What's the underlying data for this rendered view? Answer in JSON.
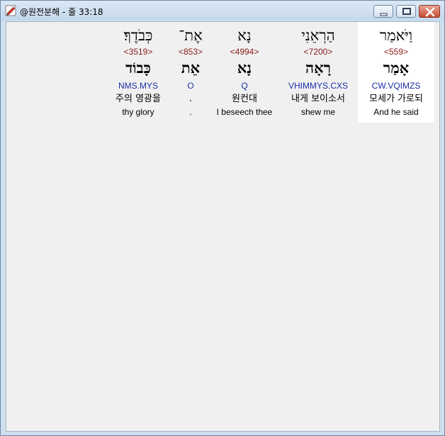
{
  "window": {
    "title": "@원전분해 - 줄 33:18",
    "colors": {
      "strong": "#8b1a1a",
      "morph": "#1a2fa8",
      "current_bg": "#ffffff"
    }
  },
  "icons": {
    "app": "app-icon",
    "minimize": "minimize-icon",
    "maximize": "maximize-icon",
    "close": "close-icon"
  },
  "words": [
    {
      "hebrew": "וַיֹּאמַר",
      "strong": "<559>",
      "lemma": "אָמַר",
      "morph": "CW.VQIMZS",
      "korean": "모세가 가로되",
      "english": "And he said"
    },
    {
      "hebrew": "הַרְאֵנִי",
      "strong": "<7200>",
      "lemma": "רָאָה",
      "morph": "VHIMMYS.CXS",
      "korean": "내게 보이소서",
      "english": "shew me"
    },
    {
      "hebrew": "נָא",
      "strong": "<4994>",
      "lemma": "נָא",
      "morph": "Q",
      "korean": "원컨대",
      "english": "I beseech thee"
    },
    {
      "hebrew": "אֶת־",
      "strong": "<853>",
      "lemma": "אֵת",
      "morph": "O",
      "korean": ".",
      "english": "."
    },
    {
      "hebrew": "כְּבֹדֶךָ׃",
      "strong": "<3519>",
      "lemma": "כָּבוֹד",
      "morph": "NMS.MYS",
      "korean": "주의 영광을",
      "english": "thy glory"
    }
  ]
}
